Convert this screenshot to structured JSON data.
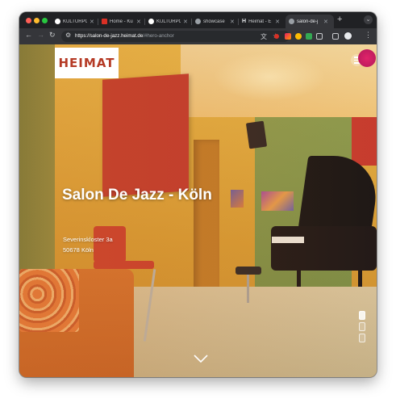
{
  "browser": {
    "tabs": [
      {
        "label": "KULTURPO",
        "favicon_color": "#ffffff"
      },
      {
        "label": "Home - Ku",
        "favicon_color": "#d93025"
      },
      {
        "label": "KULTURPO",
        "favicon_color": "#ffffff"
      },
      {
        "label": "showcase",
        "favicon_color": "#9aa0a6"
      },
      {
        "label": "Heimat - E",
        "favicon_color": "#e8eaed"
      },
      {
        "label": "salon-de-j",
        "favicon_color": "#9aa0a6",
        "active": true
      }
    ],
    "new_tab_label": "+",
    "url_main": "https://salon-de-jazz.heimat.de",
    "url_rest": "/#hero-anchor"
  },
  "site": {
    "logo_text": "HEIMAT",
    "title": "Salon De Jazz - Köln",
    "address_line1": "Severinskloster 3a",
    "address_line2": "50678 Köln"
  },
  "colors": {
    "logo_red": "#b53a25",
    "wall_orange": "#d9a23a",
    "panel_red": "#c0352d"
  }
}
